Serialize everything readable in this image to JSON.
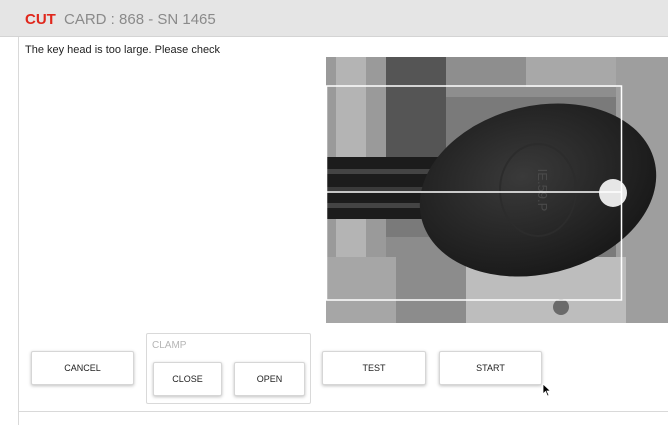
{
  "header": {
    "mode": "CUT",
    "card_info": "CARD : 868 - SN 1465"
  },
  "message": "The key head is too large. Please check",
  "camera": {
    "key_engraving": "IE.59.P"
  },
  "buttons": {
    "cancel": "CANCEL",
    "test": "TEST",
    "start": "START"
  },
  "clamp": {
    "label": "CLAMP",
    "close": "CLOSE",
    "open": "OPEN"
  },
  "colors": {
    "accent": "#e0271c",
    "header_bg": "#e5e5e5"
  }
}
